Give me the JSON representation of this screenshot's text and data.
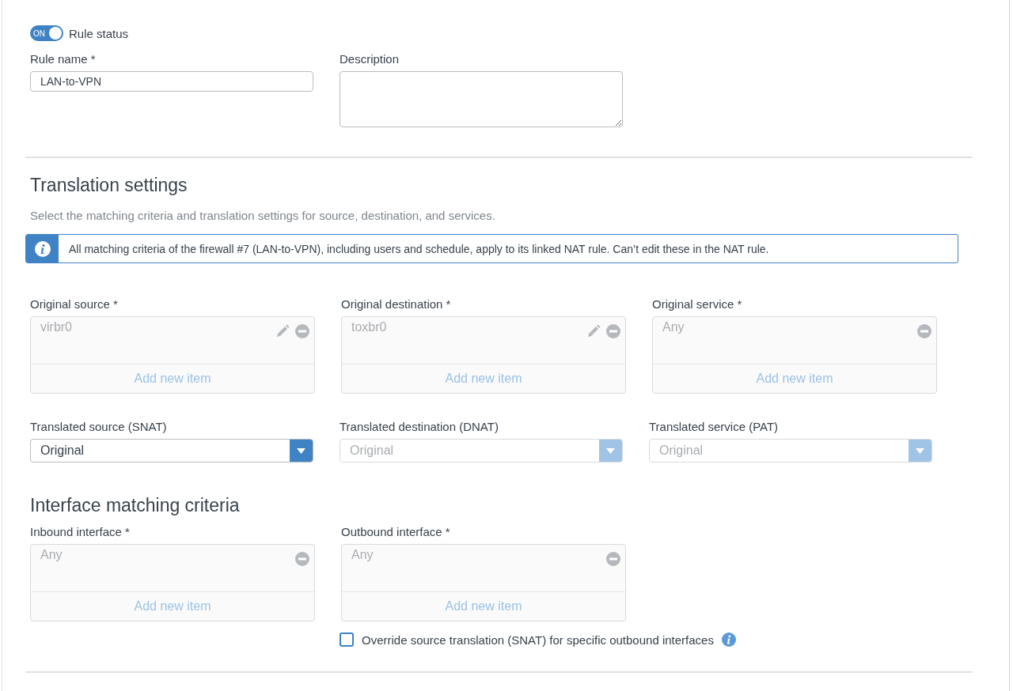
{
  "rule_status": {
    "label": "Rule status",
    "on": true,
    "toggle_text": "ON"
  },
  "rule_name": {
    "label": "Rule name *",
    "value": "LAN-to-VPN"
  },
  "description": {
    "label": "Description"
  },
  "translation_settings": {
    "title": "Translation settings",
    "subtitle": "Select the matching criteria and translation settings for source, destination, and services.",
    "banner": "All matching criteria of the firewall #7 (LAN-to-VPN), including users and schedule, apply to its linked NAT rule. Can’t edit these in the NAT rule.",
    "pickers": [
      {
        "label": "Original source *",
        "item": "virbr0",
        "editable": true,
        "add_label": "Add new item"
      },
      {
        "label": "Original destination *",
        "item": "toxbr0",
        "editable": true,
        "add_label": "Add new item"
      },
      {
        "label": "Original service *",
        "item": "Any",
        "editable": false,
        "add_label": "Add new item"
      }
    ],
    "selects": [
      {
        "label": "Translated source (SNAT)",
        "value": "Original",
        "disabled": false
      },
      {
        "label": "Translated destination (DNAT)",
        "value": "Original",
        "disabled": true
      },
      {
        "label": "Translated service (PAT)",
        "value": "Original",
        "disabled": true
      }
    ]
  },
  "interface_matching": {
    "title": "Interface matching criteria",
    "pickers": [
      {
        "label": "Inbound interface *",
        "item": "Any",
        "editable": false,
        "add_label": "Add new item"
      },
      {
        "label": "Outbound interface *",
        "item": "Any",
        "editable": false,
        "add_label": "Add new item"
      }
    ],
    "override": {
      "label": "Override source translation (SNAT) for specific outbound interfaces",
      "checked": false
    }
  }
}
